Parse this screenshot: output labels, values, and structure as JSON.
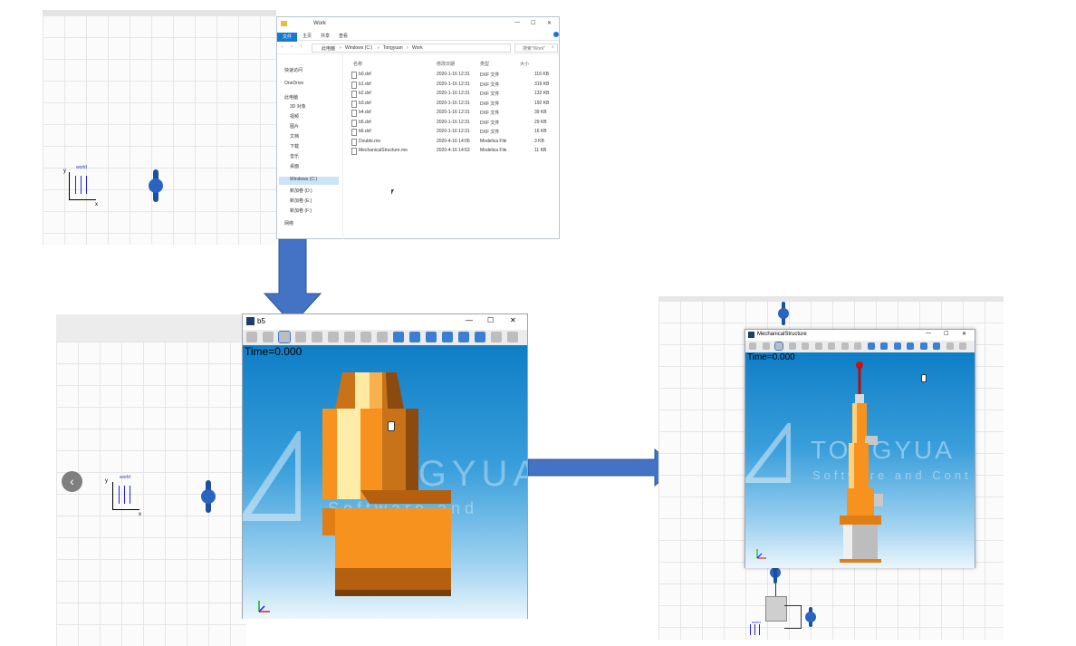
{
  "explorer": {
    "title": "Work",
    "ribbon_tabs": [
      "文件",
      "主页",
      "共享",
      "查看"
    ],
    "path": [
      "此电脑",
      "Windows (C:)",
      "Tongyuan",
      "Work"
    ],
    "search_placeholder": "搜索\"Work\"",
    "nav_items": [
      "快速访问",
      "OneDrive",
      "此电脑",
      "3D 对象",
      "视频",
      "图片",
      "文档",
      "下载",
      "音乐",
      "桌面",
      "Windows (C:)",
      "新加卷 (D:)",
      "新加卷 (E:)",
      "新加卷 (F:)",
      "网络"
    ],
    "columns": [
      "名称",
      "修改日期",
      "类型",
      "大小"
    ],
    "files": [
      {
        "name": "b0.dxf",
        "date": "2020-1-16 12:31",
        "type": "DXF 文件",
        "size": "116 KB"
      },
      {
        "name": "b1.dxf",
        "date": "2020-1-16 12:31",
        "type": "DXF 文件",
        "size": "319 KB"
      },
      {
        "name": "b2.dxf",
        "date": "2020-1-16 12:31",
        "type": "DXF 文件",
        "size": "132 KB"
      },
      {
        "name": "b3.dxf",
        "date": "2020-1-16 12:31",
        "type": "DXF 文件",
        "size": "192 KB"
      },
      {
        "name": "b4.dxf",
        "date": "2020-1-16 12:31",
        "type": "DXF 文件",
        "size": "39 KB"
      },
      {
        "name": "b5.dxf",
        "date": "2020-1-16 12:31",
        "type": "DXF 文件",
        "size": "29 KB"
      },
      {
        "name": "b6.dxf",
        "date": "2020-1-16 12:31",
        "type": "DXF 文件",
        "size": "16 KB"
      },
      {
        "name": "Double.mo",
        "date": "2020-4-16 14:06",
        "type": "Modelica File",
        "size": "3 KB"
      },
      {
        "name": "MechanicalStructure.mo",
        "date": "2020-4-16 14:53",
        "type": "Modelica File",
        "size": "11 KB"
      }
    ]
  },
  "diagram": {
    "world_label": "world",
    "x_axis": "x",
    "y_axis": "y"
  },
  "viewer_b5": {
    "title": "b5",
    "time": "Time=0.000"
  },
  "viewer_mech": {
    "title": "MechanicalStructure",
    "time": "Time=0.000"
  },
  "watermark": {
    "brand": "TONGYUA",
    "tagline": "Software and Cont"
  },
  "window_controls": {
    "minimize": "—",
    "maximize": "☐",
    "close": "✕"
  },
  "colors": {
    "arrow": "#4472c4",
    "orange": "#f7921e",
    "scene_top": "#0f7ec7",
    "scene_bottom": "#eaf6fd",
    "explorer_accent": "#1979ca"
  }
}
